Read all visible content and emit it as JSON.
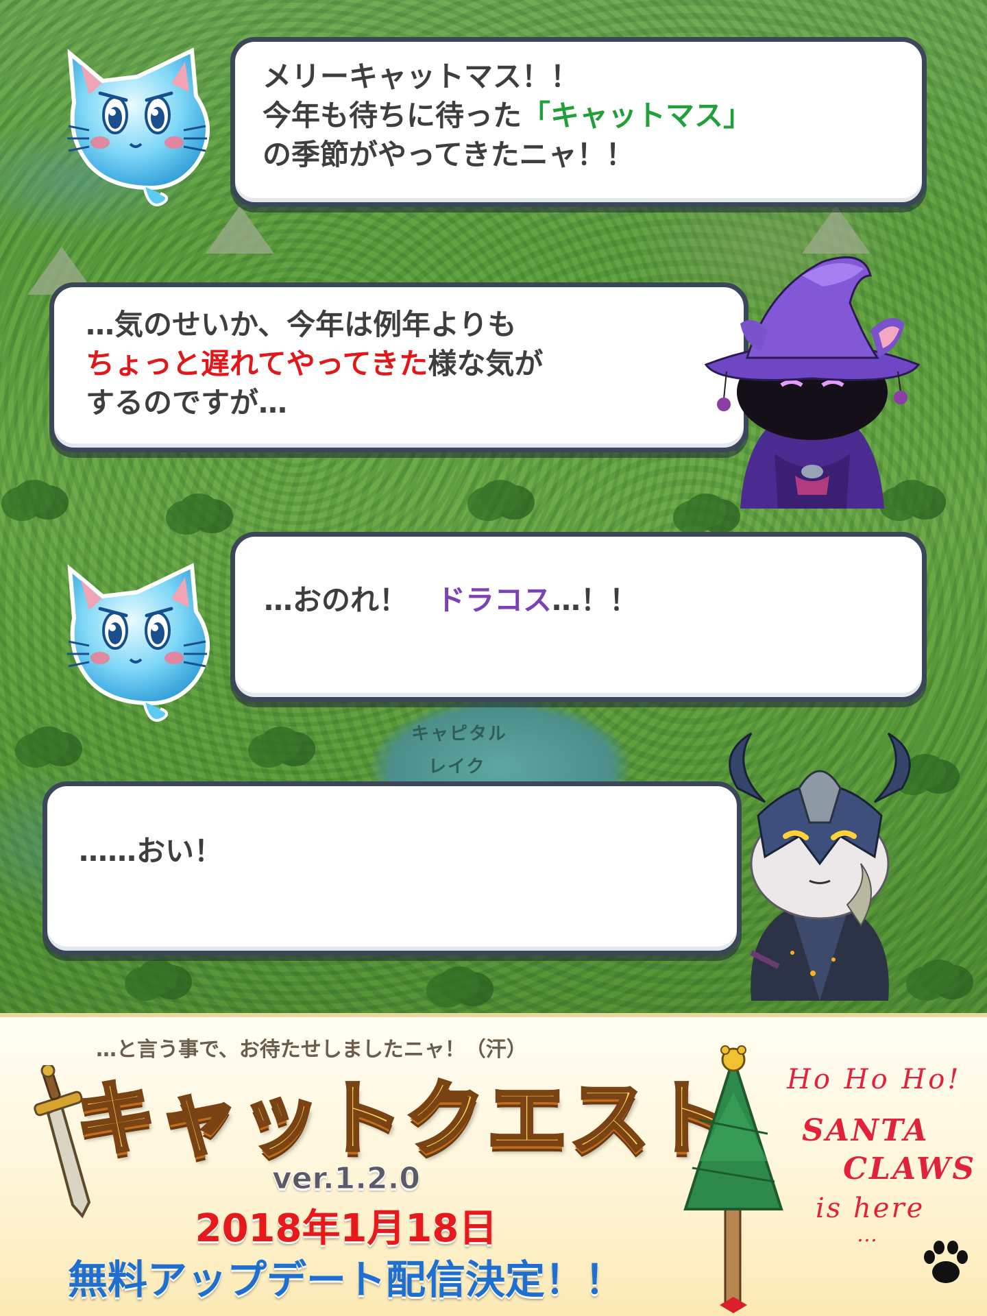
{
  "dialogue": {
    "bubble1": {
      "line1": "メリーキャットマス！！",
      "line2_pre": "今年も待ちに待った",
      "line2_highlight": "「キャットマス」",
      "line3": "の季節がやってきたニャ！！"
    },
    "bubble2": {
      "line1": "…気のせいか、今年は例年よりも",
      "line2_highlight": "ちょっと遅れてやってきた",
      "line2_post": "様な気が",
      "line3": "するのですが…"
    },
    "bubble3": {
      "pre": "…おのれ！",
      "highlight": "ドラコス",
      "post": "…！！"
    },
    "bubble4": {
      "line1": "……おい！"
    }
  },
  "map": {
    "lake_label_1": "キャピタル",
    "lake_label_2": "レイク"
  },
  "banner": {
    "subtitle": "…と言う事で、お待たせしましたニャ！（汗）",
    "logo": "キャットクエスト",
    "version": "ver.1.2.0",
    "date": "2018年1月18日",
    "announcement": "無料アップデート配信決定！！",
    "handwritten": {
      "line1": "Ho Ho Ho!",
      "line2": "SANTA",
      "line3": "CLAWS",
      "line4": "is here",
      "line5": "…"
    }
  },
  "colors": {
    "bubble_border": "#3b4759",
    "highlight_red": "#e0181a",
    "highlight_green": "#21a03a",
    "highlight_purple": "#7a42b2",
    "announce_blue": "#1f6fd1"
  },
  "icons": [
    "blue-cat-spirit-icon",
    "purple-wizard-cat-icon",
    "horned-knight-cat-icon",
    "sword-icon",
    "christmas-tree-icon",
    "paw-print-icon"
  ]
}
